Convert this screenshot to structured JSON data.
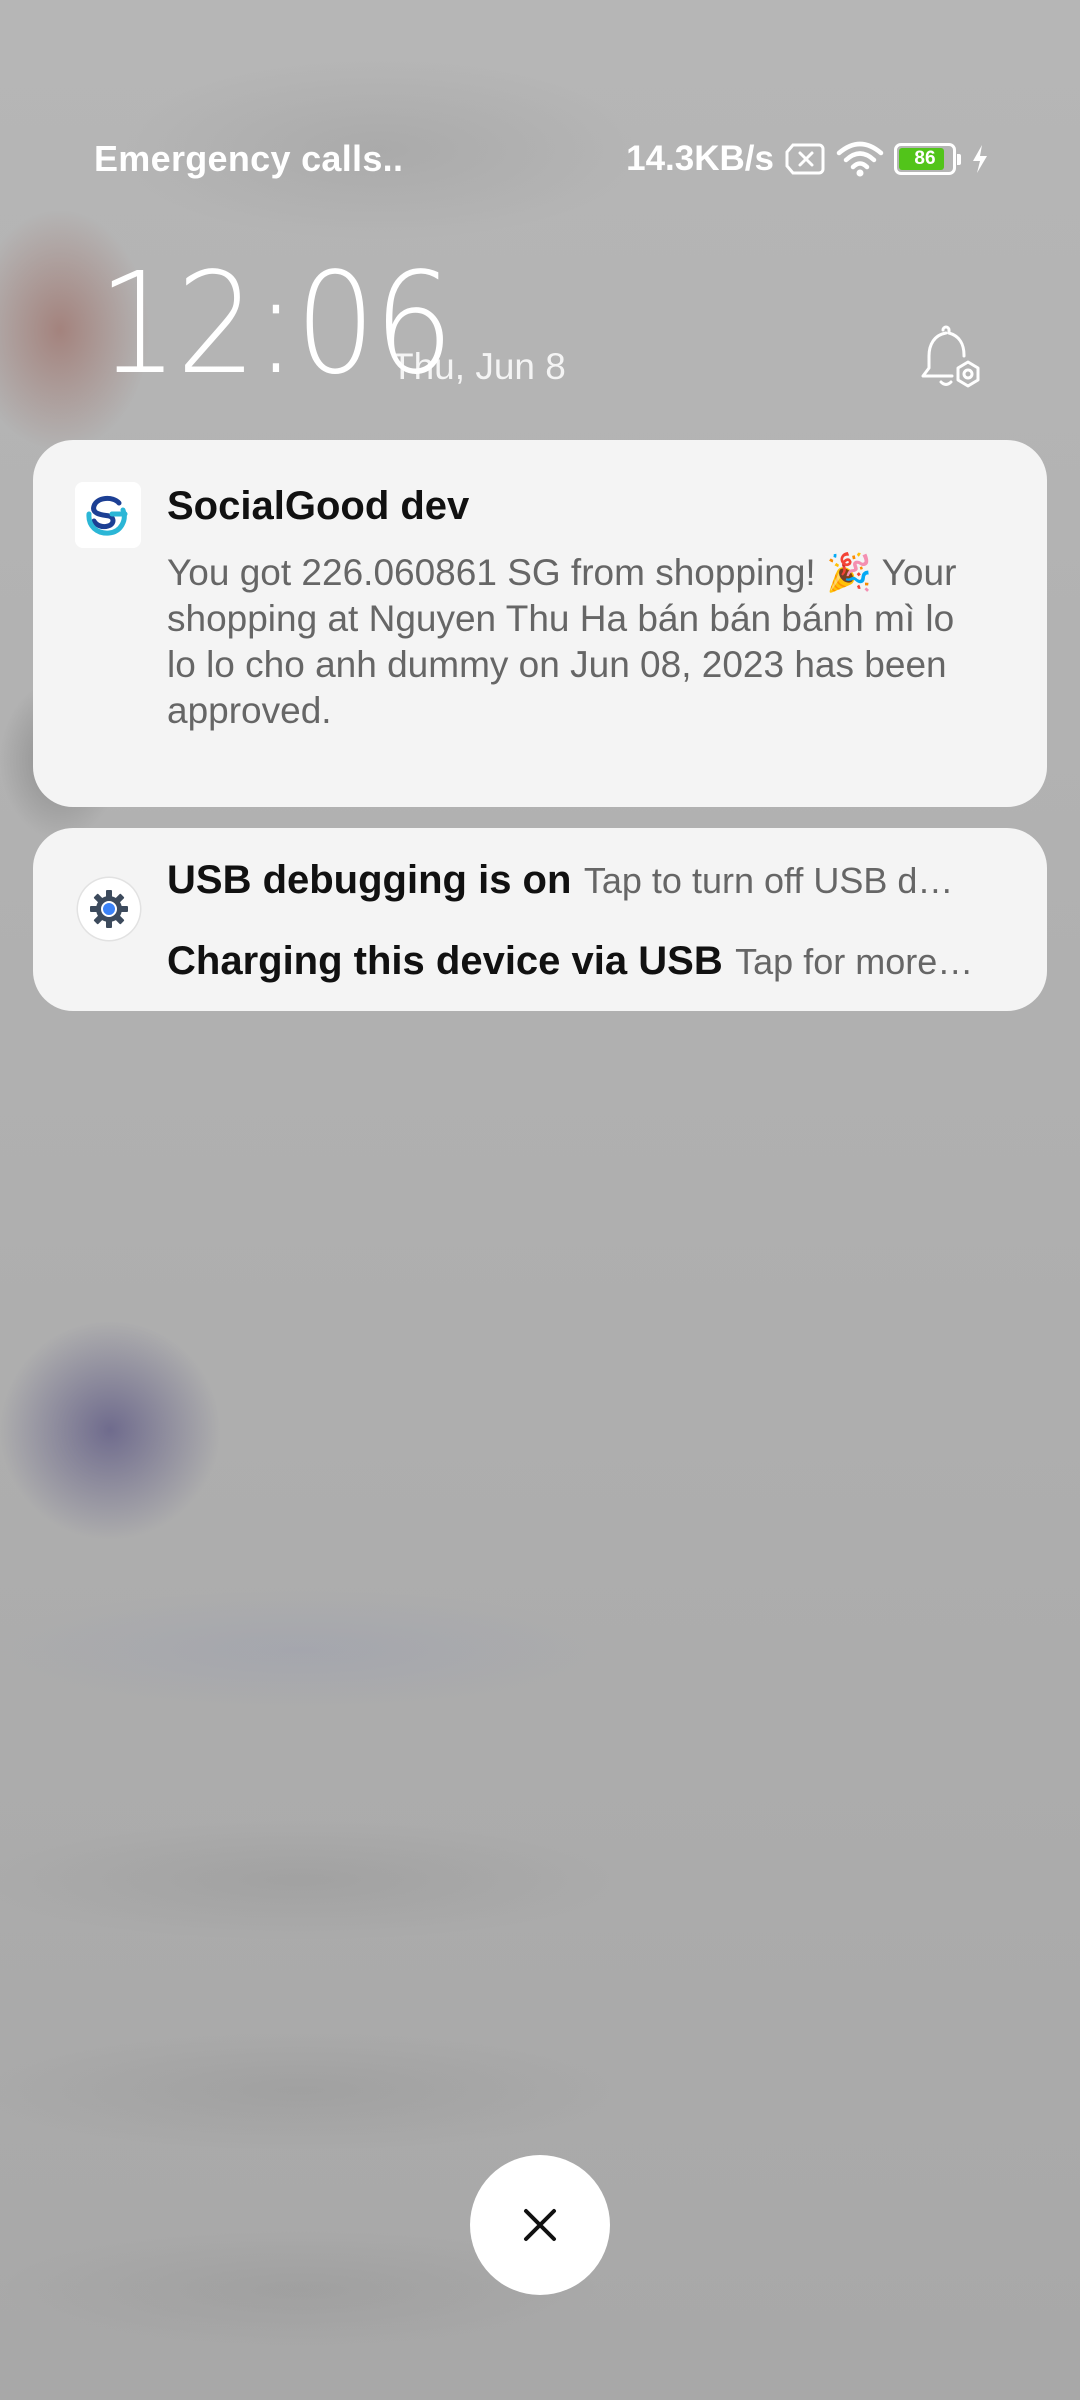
{
  "status_bar": {
    "carrier_text": "Emergency calls..",
    "network_speed": "14.3KB/s",
    "battery_level": "86",
    "battery_fraction": 0.86,
    "charging": true,
    "icons": [
      "no-sim-icon",
      "wifi-icon",
      "battery-icon",
      "charging-bolt-icon"
    ]
  },
  "lockscreen": {
    "time": "12:06",
    "date": "Thu, Jun 8",
    "bell_icon": "notification-settings-icon"
  },
  "notifications": [
    {
      "app_name": "SocialGood dev",
      "icon": "socialgood-app-icon",
      "body": "You got 226.060861 SG from shopping! 🎉 Your shopping at Nguyen Thu Ha bán bán bánh mì lo lo lo cho anh dummy on Jun 08, 2023 has been approved."
    },
    {
      "icon": "android-settings-icon",
      "items": [
        {
          "title": "USB debugging is on",
          "text": "Tap to turn off USB d…"
        },
        {
          "title": "Charging this device via USB",
          "text": "Tap for more…"
        }
      ]
    }
  ],
  "close_button": {
    "icon": "close-icon"
  },
  "colors": {
    "accent_green": "#52c41a",
    "card_bg": "#f4f4f4",
    "socialgood_blue": "#1a73e8"
  }
}
